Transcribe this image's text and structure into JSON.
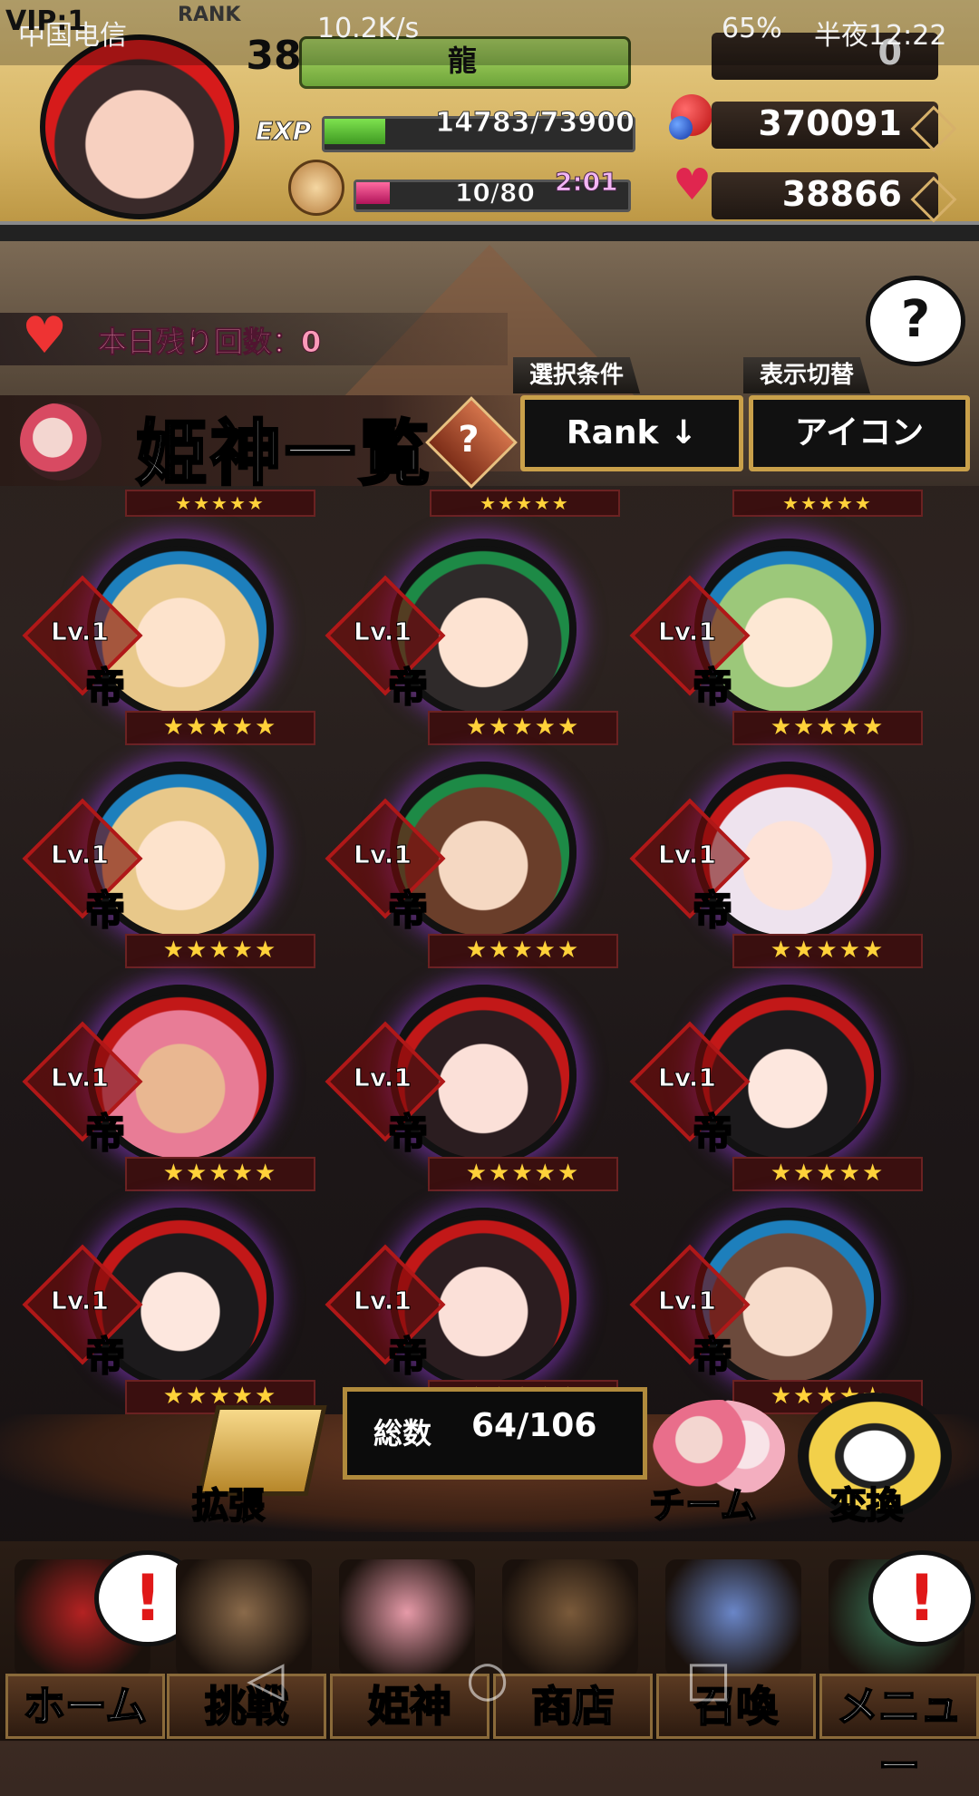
{
  "status_bar": {
    "carrier": "中国电信",
    "speed": "10.2K/s",
    "battery": "65%",
    "time": "半夜12:22"
  },
  "header": {
    "vip": "VIP:1",
    "rank_label": "RANK",
    "level": "38",
    "player_name": "龍",
    "exp_label": "EXP",
    "exp_text": "14783/73900",
    "exp_progress": 0.2,
    "stamina_text": "10/80",
    "stamina_progress": 0.125,
    "stamina_timer": "2:01",
    "top_counter": "0",
    "gems": "370091",
    "hearts": "38866"
  },
  "remaining": {
    "text": "本日残り回数：0"
  },
  "help": {
    "symbol": "?"
  },
  "title": {
    "text": "姫神一覧",
    "help_symbol": "?"
  },
  "filters": {
    "select_label": "選択条件",
    "select_value": "Rank ↓",
    "display_label": "表示切替",
    "display_value": "アイコン"
  },
  "cards": [
    {
      "level": "Lv.1",
      "rank": "帝",
      "stars": "★★★★★",
      "style": "hair-blonde"
    },
    {
      "level": "Lv.1",
      "rank": "帝",
      "stars": "★★★★★",
      "style": "hair-dark-g"
    },
    {
      "level": "Lv.1",
      "rank": "帝",
      "stars": "★★★★★",
      "style": "hair-greenhair"
    },
    {
      "level": "Lv.1",
      "rank": "帝",
      "stars": "★★★★★",
      "style": "hair-blonde"
    },
    {
      "level": "Lv.1",
      "rank": "帝",
      "stars": "★★★★★",
      "style": "hair-brown-g"
    },
    {
      "level": "Lv.1",
      "rank": "帝",
      "stars": "★★★★★",
      "style": "hair-white-r"
    },
    {
      "level": "Lv.1",
      "rank": "帝",
      "stars": "★★★★★",
      "style": "hair-pink-r"
    },
    {
      "level": "Lv.1",
      "rank": "帝",
      "stars": "★★★★★",
      "style": "hair-dark-r"
    },
    {
      "level": "Lv.1",
      "rank": "帝",
      "stars": "★★★★★",
      "style": "hair-black-r"
    },
    {
      "level": "Lv.1",
      "rank": "帝",
      "stars": "★★★★★",
      "style": "hair-black-r"
    },
    {
      "level": "Lv.1",
      "rank": "帝",
      "stars": "★★★★★",
      "style": "hair-dark-r"
    },
    {
      "level": "Lv.1",
      "rank": "帝",
      "stars": "★★★★★",
      "style": "hair-brown-b"
    }
  ],
  "top_partial_stars": "★★★★★",
  "footer": {
    "total_label": "総数",
    "total_value": "64/106",
    "expand_label": "拡張",
    "team_label": "チーム",
    "convert_label": "変換"
  },
  "nav": {
    "items": [
      {
        "label": "ホーム",
        "alert": "!"
      },
      {
        "label": "挑戦"
      },
      {
        "label": "姫神"
      },
      {
        "label": "商店"
      },
      {
        "label": "召喚"
      },
      {
        "label": "メニュー",
        "alert": "!"
      }
    ]
  },
  "colors": {
    "header_gold": "#d6b463",
    "frame_purple_glow": "#9640dc",
    "rank_purple": "#c46de0",
    "star_yellow": "#ffd23a",
    "alert_red": "#e01818"
  }
}
